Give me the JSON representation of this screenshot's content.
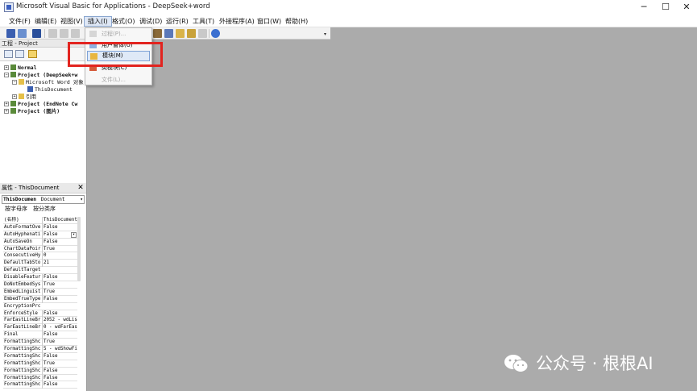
{
  "window": {
    "title": "Microsoft Visual Basic for Applications - DeepSeek+word",
    "minimize_glyph": "─",
    "maximize_glyph": "☐",
    "close_glyph": "✕"
  },
  "menubar": {
    "items": [
      "文件(F)",
      "编辑(E)",
      "视图(V)",
      "插入(I)",
      "格式(O)",
      "调试(D)",
      "运行(R)",
      "工具(T)",
      "外接程序(A)",
      "窗口(W)",
      "帮助(H)"
    ],
    "active_index": 3
  },
  "insert_menu": {
    "items": [
      {
        "label": "过程(P)...",
        "enabled": false,
        "icon": "procedure-icon"
      },
      {
        "label": "用户窗体(U)",
        "enabled": true,
        "icon": "userform-icon"
      },
      {
        "label": "模块(M)",
        "enabled": true,
        "icon": "module-icon",
        "highlighted": true
      },
      {
        "label": "类模块(C)",
        "enabled": true,
        "icon": "class-module-icon"
      },
      {
        "label": "文件(L)...",
        "enabled": false,
        "icon": ""
      }
    ]
  },
  "project_pane": {
    "title": "工程 - Project",
    "tree": [
      {
        "label": "Normal",
        "bold": true,
        "level": 0,
        "expander": "+"
      },
      {
        "label": "Project (DeepSeek+w",
        "bold": true,
        "level": 0,
        "expander": "−"
      },
      {
        "label": "Microsoft Word 对象",
        "bold": false,
        "level": 1,
        "expander": "−"
      },
      {
        "label": "ThisDocument",
        "bold": false,
        "level": 2,
        "expander": ""
      },
      {
        "label": "引用",
        "bold": false,
        "level": 1,
        "expander": "+"
      },
      {
        "label": "Project (EndNote Cw",
        "bold": true,
        "level": 0,
        "expander": "+"
      },
      {
        "label": "Project (图片)",
        "bold": true,
        "level": 0,
        "expander": "+"
      }
    ]
  },
  "properties_pane": {
    "title": "属性 - ThisDocument",
    "close_glyph": "✕",
    "object_name": "ThisDocumen",
    "object_type": "Document",
    "tabs": [
      "按字母序",
      "按分类序"
    ],
    "rows": [
      [
        "(名称)",
        "ThisDocument"
      ],
      [
        "AutoFormatOve",
        "False"
      ],
      [
        "AutoHyphenati",
        "False"
      ],
      [
        "AutoSaveOn",
        "False"
      ],
      [
        "ChartDataPoir",
        "True"
      ],
      [
        "ConsecutiveHy",
        "0"
      ],
      [
        "DefaultTabSto",
        "21"
      ],
      [
        "DefaultTarget",
        ""
      ],
      [
        "DisableFeatur",
        "False"
      ],
      [
        "DoNotEmbedSys",
        "True"
      ],
      [
        "EmbedLinguist",
        "True"
      ],
      [
        "EmbedTrueType",
        "False"
      ],
      [
        "EncryptionPrc",
        ""
      ],
      [
        "EnforceStyle",
        "False"
      ],
      [
        "FarEastLineBr",
        "2052 - wdLis"
      ],
      [
        "FarEastLineBr",
        "0 - wdFarEas"
      ],
      [
        "Final",
        "False"
      ],
      [
        "FormattingShc",
        "True"
      ],
      [
        "FormattingShc",
        "5 - wdShowFi"
      ],
      [
        "FormattingShc",
        "False"
      ],
      [
        "FormattingShc",
        "True"
      ],
      [
        "FormattingShc",
        "False"
      ],
      [
        "FormattingShc",
        "False"
      ],
      [
        "FormattingShc",
        "False"
      ]
    ]
  },
  "watermark": {
    "text": "公众号 · 根根AI"
  },
  "colors": {
    "highlight_box": "#e2241f",
    "main_background": "#ababab"
  }
}
